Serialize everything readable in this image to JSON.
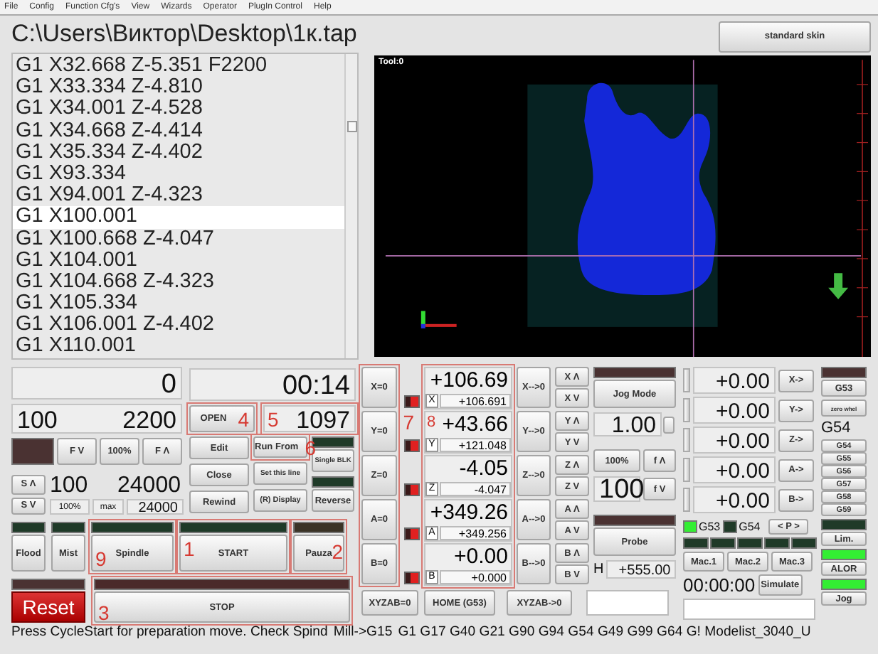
{
  "menu": [
    "File",
    "Config",
    "Function Cfg's",
    "View",
    "Wizards",
    "Operator",
    "PlugIn Control",
    "Help"
  ],
  "file_path": "C:\\Users\\Виктор\\Desktop\\1к.tap",
  "gcode_lines": [
    {
      "text": "G1 X32.668 Z-5.351 F2200",
      "selected": false
    },
    {
      "text": "G1 X33.334 Z-4.810",
      "selected": false
    },
    {
      "text": "G1 X34.001 Z-4.528",
      "selected": false
    },
    {
      "text": "G1 X34.668 Z-4.414",
      "selected": false
    },
    {
      "text": "G1 X35.334 Z-4.402",
      "selected": false
    },
    {
      "text": "G1 X93.334",
      "selected": false
    },
    {
      "text": "G1 X94.001 Z-4.323",
      "selected": false
    },
    {
      "text": "G1 X100.001",
      "selected": true
    },
    {
      "text": "G1 X100.668 Z-4.047",
      "selected": false
    },
    {
      "text": "G1 X104.001",
      "selected": false
    },
    {
      "text": "G1 X104.668 Z-4.323",
      "selected": false
    },
    {
      "text": "G1 X105.334",
      "selected": false
    },
    {
      "text": "G1 X106.001 Z-4.402",
      "selected": false
    },
    {
      "text": "G1 X110.001",
      "selected": false
    }
  ],
  "skin_button": "standard skin",
  "toolpath": {
    "tool_label": "Tool:0"
  },
  "program": {
    "line_counter": "0",
    "elapsed": "00:14",
    "open": {
      "label": "OPEN",
      "annotation": "4"
    },
    "line_number": {
      "value": "1097",
      "annotation": "5"
    },
    "edit": "Edit",
    "run_from": {
      "label": "Run From",
      "annotation": "6"
    },
    "single_block": {
      "label": "Single BLK",
      "led_on": false
    },
    "close": "Close",
    "set_line": "Set this line",
    "rewind": "Rewind",
    "display": "(R) Display",
    "reverse": {
      "label": "Reverse",
      "led_on": false
    }
  },
  "feed": {
    "override": "100",
    "rate": "2200",
    "led_on": false,
    "buttons": [
      "F V",
      "100%",
      "F Λ"
    ]
  },
  "spindle": {
    "up": "S Λ",
    "down": "S V",
    "override": "100",
    "rpm": "24000",
    "reset_pct": "100%",
    "max_label": "max",
    "max_value": "24000"
  },
  "controls": [
    {
      "label": "Flood",
      "led_on": false
    },
    {
      "label": "Mist",
      "led_on": false
    },
    {
      "label": "Spindle",
      "led_on": false,
      "annotation": "9"
    },
    {
      "label": "START",
      "led_on": false,
      "annotation": "1"
    },
    {
      "label": "Pauza",
      "led_on": false,
      "annotation": "2"
    }
  ],
  "reset": {
    "label": "Reset",
    "led_on": false
  },
  "stop": {
    "label": "STOP",
    "led_on": false,
    "annotation": "3"
  },
  "axes_panel": {
    "zero_annotation": "7",
    "dro_annotation": "8"
  },
  "axes": [
    {
      "letter": "X",
      "zero": "X=0",
      "value": "+106.69",
      "machine": "+106.691",
      "goto": "X-->0",
      "jog_up": "X Λ",
      "jog_down": "X V"
    },
    {
      "letter": "Y",
      "zero": "Y=0",
      "value": "+43.66",
      "machine": "+121.048",
      "goto": "Y-->0",
      "jog_up": "Y Λ",
      "jog_down": "Y V"
    },
    {
      "letter": "Z",
      "zero": "Z=0",
      "value": "-4.05",
      "machine": "-4.047",
      "goto": "Z-->0",
      "jog_up": "Z Λ",
      "jog_down": "Z V"
    },
    {
      "letter": "A",
      "zero": "A=0",
      "value": "+349.26",
      "machine": "+349.256",
      "goto": "A-->0",
      "jog_up": "A Λ",
      "jog_down": "A V"
    },
    {
      "letter": "B",
      "zero": "B=0",
      "value": "+0.00",
      "machine": "+0.000",
      "goto": "B-->0",
      "jog_up": "B Λ",
      "jog_down": "B V"
    }
  ],
  "axis_buttons": [
    "XYZAB=0",
    "HOME (G53)",
    "XYZAB->0"
  ],
  "jog": {
    "mode": {
      "label": "Jog Mode",
      "led_on": false
    },
    "step": "1.00",
    "rate_pct": "100%",
    "rate_up": "f Λ",
    "rate": "100",
    "rate_down": "f V",
    "probe": {
      "label": "Probe",
      "led_on": false
    },
    "h_label": "H",
    "h_value": "+555.00"
  },
  "offsets": [
    {
      "value": "+0.00",
      "button": "X->"
    },
    {
      "value": "+0.00",
      "button": "Y->"
    },
    {
      "value": "+0.00",
      "button": "Z->"
    },
    {
      "value": "+0.00",
      "button": "A->"
    },
    {
      "value": "+0.00",
      "button": "B->"
    }
  ],
  "coord_leds": [
    {
      "label": "G53",
      "on": true
    },
    {
      "label": "G54",
      "on": false
    }
  ],
  "p_button": "< P >",
  "macros": [
    "Mac.1",
    "Mac.2",
    "Mac.3"
  ],
  "sim": {
    "time": "00:00:00",
    "button": "Simulate"
  },
  "side": {
    "g53": {
      "label": "G53",
      "led_on": false
    },
    "wheel": "zero whel",
    "current": "G54",
    "fixtures": [
      "G54",
      "G55",
      "G56",
      "G57",
      "G58",
      "G59"
    ],
    "toggles": [
      {
        "label": "Lim.",
        "led_on": false
      },
      {
        "label": "ALOR",
        "led_on": true
      },
      {
        "label": "Jog",
        "led_on": true
      }
    ]
  },
  "status": {
    "message": "Press CycleStart for preparation move. Check Spind",
    "machine": "Mill->G15",
    "modes": "G1 G17 G40 G21 G90 G94 G54 G49 G99 G64 G! Modelist_3040_U"
  }
}
